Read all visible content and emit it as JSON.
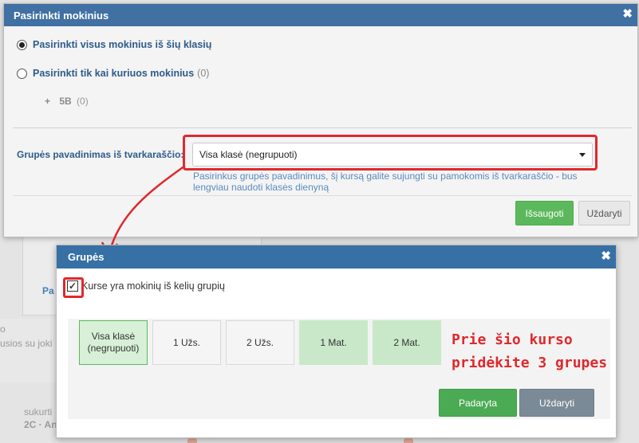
{
  "dialog1": {
    "title": "Pasirinkti mokinius",
    "close_symbol": "✖",
    "options": [
      {
        "label": "Pasirinkti visus mokinius iš šių klasių",
        "count": "",
        "selected": true
      },
      {
        "label": "Pasirinkti tik kai kuriuos mokinius",
        "count": "(0)",
        "selected": false
      }
    ],
    "class_item": {
      "name": "5B",
      "count": "(0)"
    },
    "group_field": {
      "label": "Grupės pavadinimas iš tvarkaraščio:",
      "value": "Visa klasė (negrupuoti)",
      "help": "Pasirinkus grupės pavadinimus, šį kursą galite sujungti su pamokomis iš tvarkaraščio - bus lengviau naudoti klasės dienyną"
    },
    "save_label": "Išsaugoti",
    "close_label": "Uždaryti"
  },
  "dialog2": {
    "title": "Grupės",
    "close_symbol": "✖",
    "checkbox_label": "Kurse yra mokinių iš kelių grupių",
    "checkbox_mark": "✓",
    "checkbox_checked": true,
    "groups": [
      {
        "label": "Visa klasė (negrupuoti)",
        "state": "active"
      },
      {
        "label": "1 Užs.",
        "state": "normal"
      },
      {
        "label": "2 Užs.",
        "state": "normal"
      },
      {
        "label": "1 Mat.",
        "state": "selected"
      },
      {
        "label": "2 Mat.",
        "state": "selected"
      }
    ],
    "annotation_line1": "Prie šio kurso",
    "annotation_line2": "pridėkite 3 grupes",
    "done_label": "Padaryta",
    "close_label": "Uždaryti"
  },
  "background": {
    "link_text": "Pa",
    "text_lines": [
      "o",
      "usios su joki",
      "sukurti",
      "2C · Ang"
    ]
  },
  "colors": {
    "title_bar": "#4170a3",
    "success": "#5cb85c",
    "annotation": "#e0282c"
  }
}
